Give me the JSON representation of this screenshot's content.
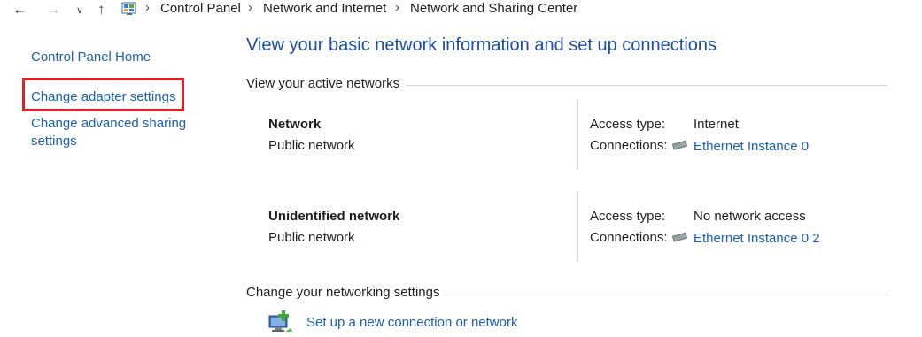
{
  "address_bar": {
    "back_icon": "back-arrow-icon",
    "forward_icon": "forward-arrow-icon",
    "recent_icon": "chevron-down-icon",
    "up_icon": "up-arrow-icon",
    "breadcrumbs": [
      "Control Panel",
      "Network and Internet",
      "Network and Sharing Center"
    ]
  },
  "sidebar": {
    "home": "Control Panel Home",
    "adapter": "Change adapter settings",
    "advanced_line1": "Change advanced sharing",
    "advanced_line2": "settings"
  },
  "main": {
    "title": "View your basic network information and set up connections",
    "active_networks_header": "View your active networks",
    "networks": [
      {
        "name": "Network",
        "category": "Public network",
        "access_label": "Access type:",
        "access_value": "Internet",
        "connections_label": "Connections:",
        "connection": "Ethernet Instance 0"
      },
      {
        "name": "Unidentified network",
        "category": "Public network",
        "access_label": "Access type:",
        "access_value": "No network access",
        "connections_label": "Connections:",
        "connection": "Ethernet Instance 0 2"
      }
    ],
    "change_settings_header": "Change your networking settings",
    "setup_link": "Set up a new connection or network"
  },
  "colors": {
    "link": "#1a5fb4",
    "title": "#1b4ea8",
    "highlight": "#e31e24"
  }
}
